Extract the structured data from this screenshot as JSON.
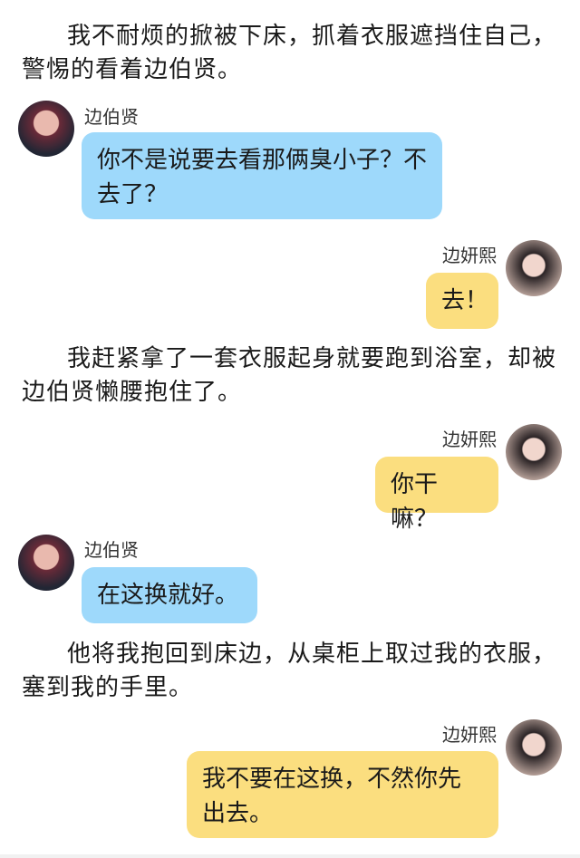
{
  "narrations": [
    "我不耐烦的掀被下床，抓着衣服遮挡住自己，警惕的看着边伯贤。",
    "我赶紧拿了一套衣服起身就要跑到浴室，却被边伯贤懒腰抱住了。",
    "他将我抱回到床边，从桌柜上取过我的衣服，塞到我的手里。"
  ],
  "messages": [
    {
      "speaker": "边伯贤",
      "text": "你不是说要去看那俩臭小子？不去了？"
    },
    {
      "speaker": "边妍熙",
      "text": "去！"
    },
    {
      "speaker": "边妍熙",
      "text": "你干嘛？"
    },
    {
      "speaker": "边伯贤",
      "text": "在这换就好。"
    },
    {
      "speaker": "边妍熙",
      "text": "我不要在这换，不然你先出去。"
    }
  ]
}
